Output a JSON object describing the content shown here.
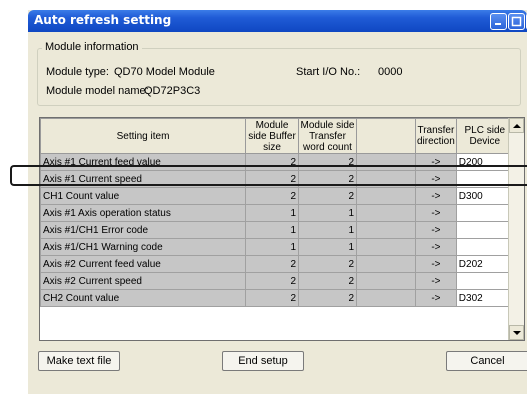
{
  "window": {
    "title": "Auto refresh setting"
  },
  "module_info": {
    "legend": "Module information",
    "type_label": "Module type:",
    "type_value": "QD70 Model Module",
    "start_io_label": "Start I/O No.:",
    "start_io_value": "0000",
    "model_label": "Module model name:",
    "model_value": "QD72P3C3"
  },
  "table": {
    "headers": {
      "setting_item": "Setting item",
      "buffer_size": "Module side Buffer size",
      "transfer_word_count": "Module side Transfer word count",
      "blank": "",
      "direction": "Transfer direction",
      "plc_device": "PLC side Device"
    },
    "rows": [
      {
        "item": "Axis #1 Current feed value",
        "buffer": "2",
        "count": "2",
        "direction": "->",
        "device": "D200"
      },
      {
        "item": "Axis #1 Current speed",
        "buffer": "2",
        "count": "2",
        "direction": "->",
        "device": ""
      },
      {
        "item": "CH1 Count value",
        "buffer": "2",
        "count": "2",
        "direction": "->",
        "device": "D300"
      },
      {
        "item": "Axis #1 Axis operation status",
        "buffer": "1",
        "count": "1",
        "direction": "->",
        "device": ""
      },
      {
        "item": "Axis #1/CH1 Error code",
        "buffer": "1",
        "count": "1",
        "direction": "->",
        "device": ""
      },
      {
        "item": "Axis #1/CH1 Warning code",
        "buffer": "1",
        "count": "1",
        "direction": "->",
        "device": ""
      },
      {
        "item": "Axis #2 Current feed value",
        "buffer": "2",
        "count": "2",
        "direction": "->",
        "device": "D202"
      },
      {
        "item": "Axis #2 Current speed",
        "buffer": "2",
        "count": "2",
        "direction": "->",
        "device": ""
      },
      {
        "item": "CH2 Count value",
        "buffer": "2",
        "count": "2",
        "direction": "->",
        "device": "D302"
      }
    ]
  },
  "buttons": {
    "make_text_file": "Make text file",
    "end_setup": "End setup",
    "cancel": "Cancel"
  },
  "colors": {
    "title_bar": "#1f5bd6",
    "readonly_cell": "#c6c6c6",
    "editable_cell": "#ffffff"
  }
}
